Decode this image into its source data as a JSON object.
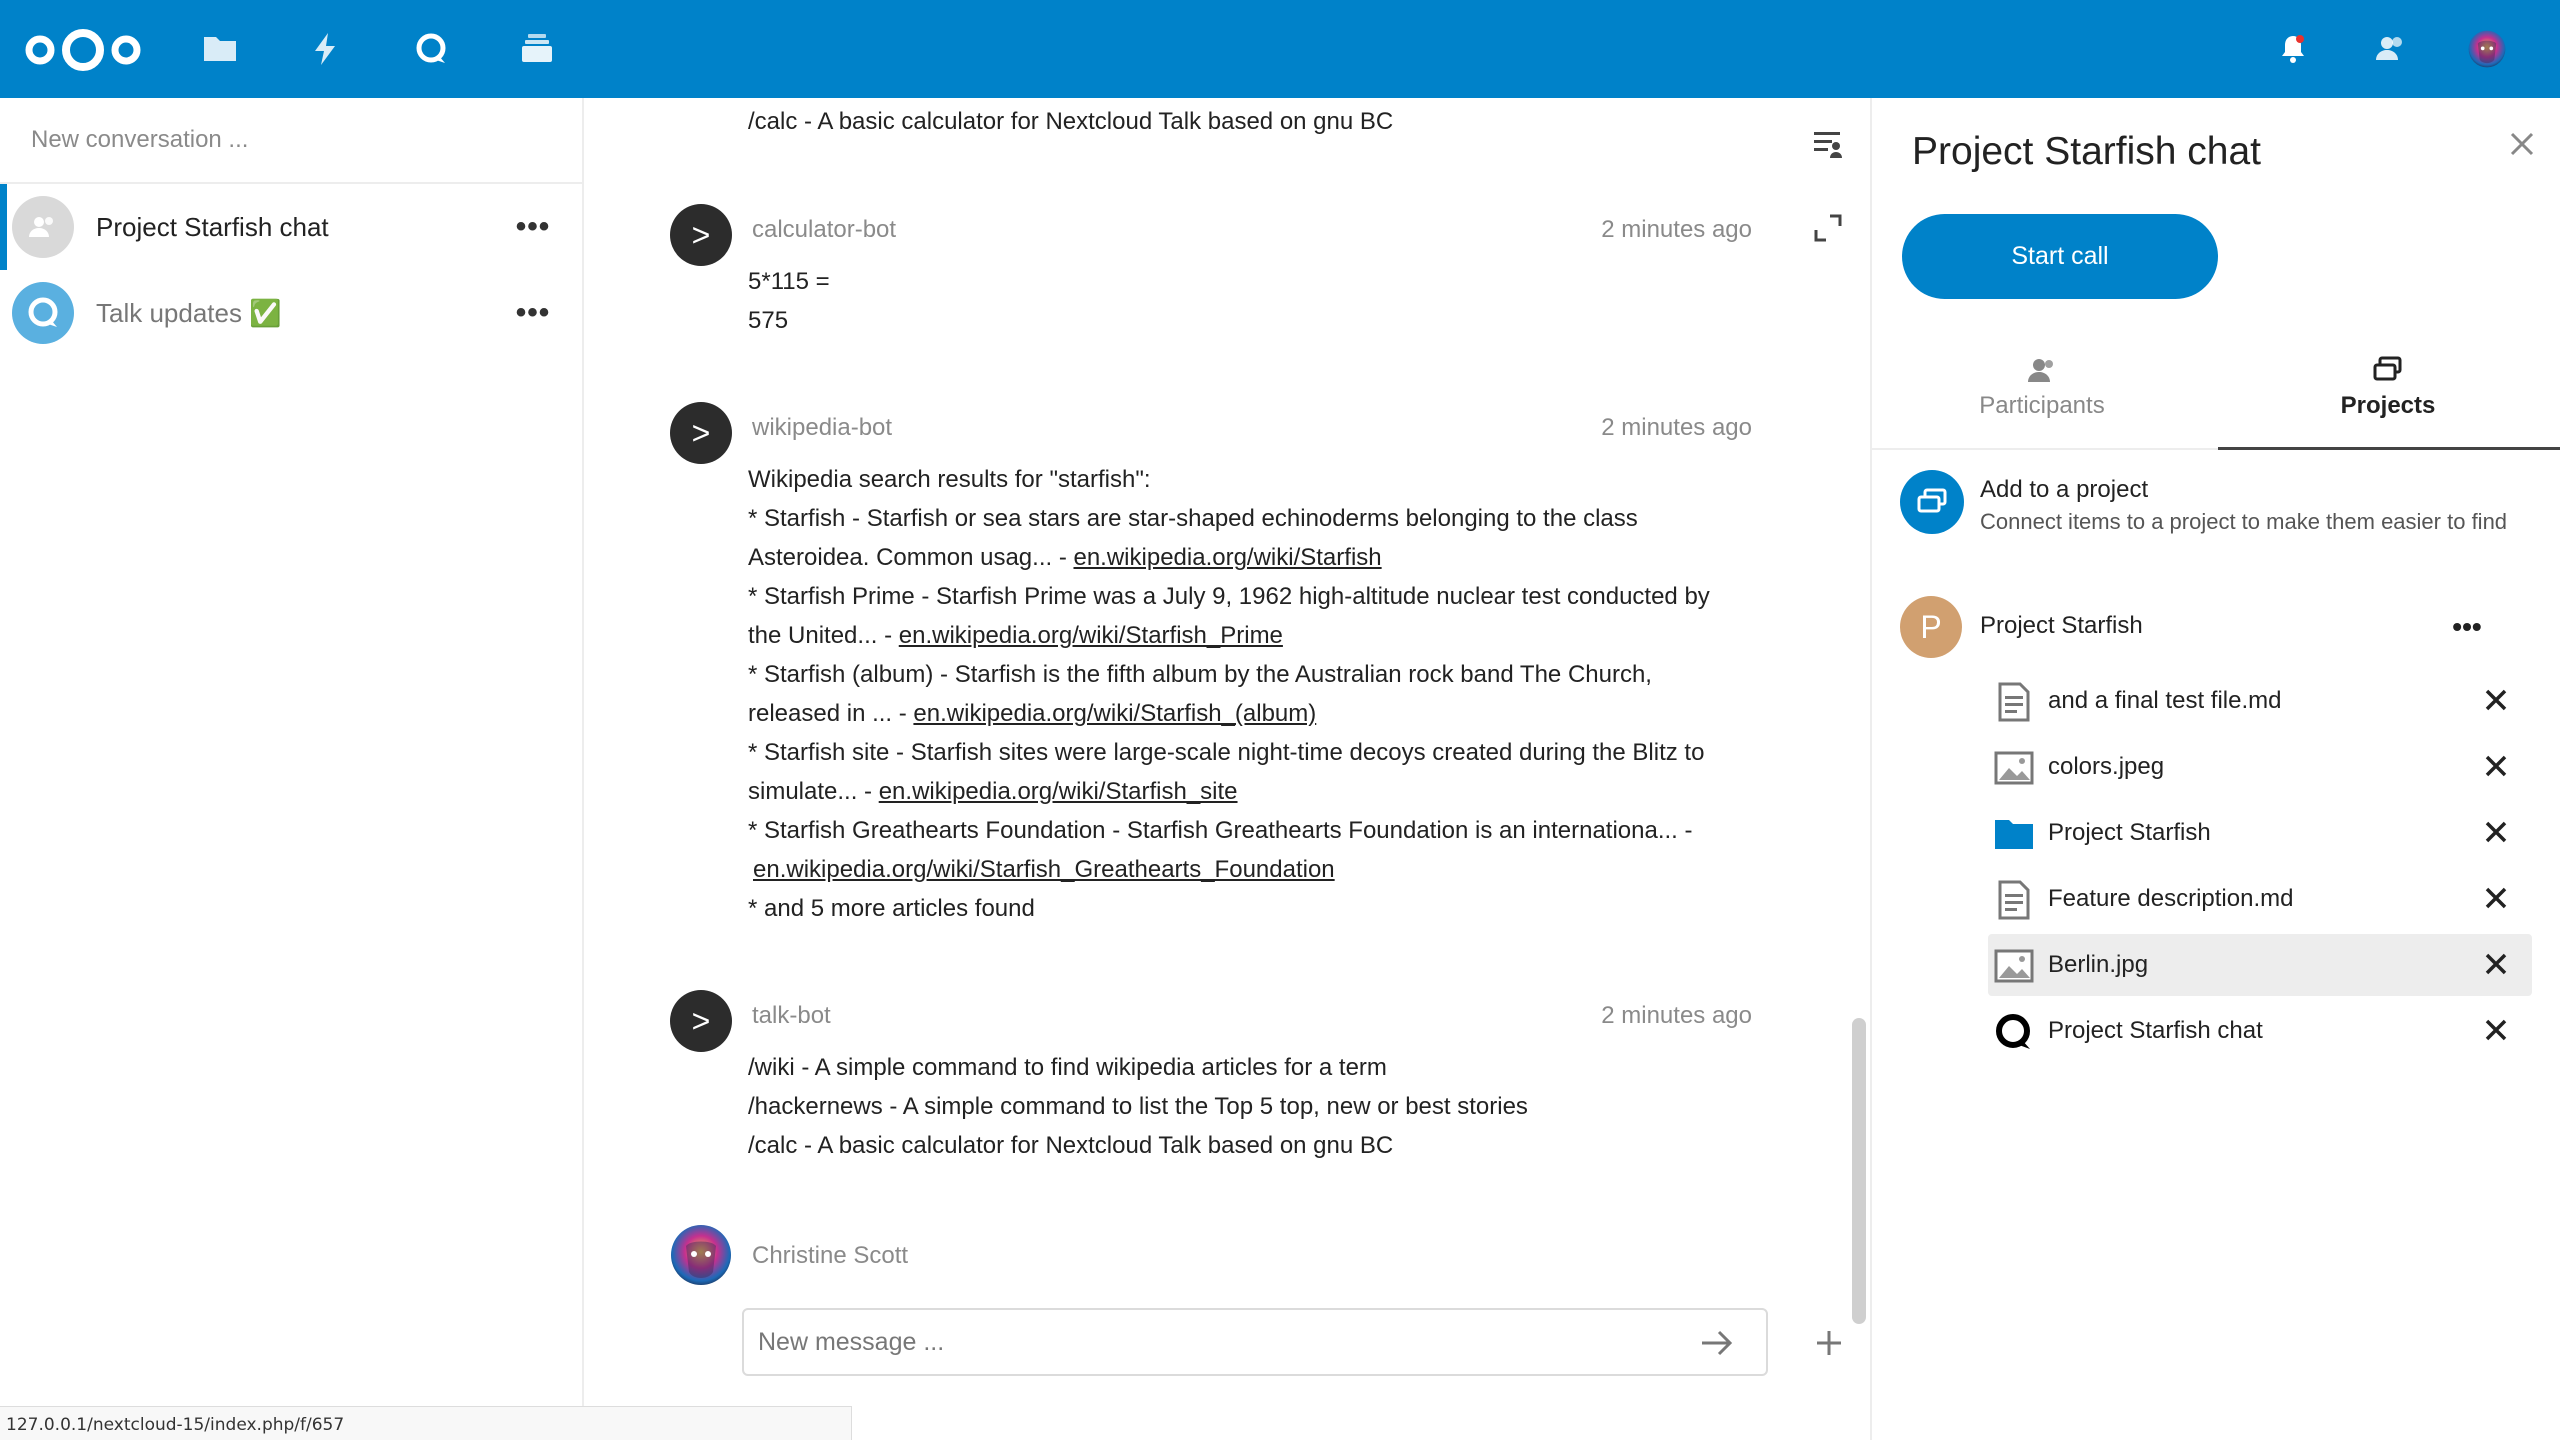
{
  "header": {
    "app_icons": [
      "files-icon",
      "activity-icon",
      "talk-icon",
      "deck-icon"
    ],
    "right_icons": [
      "notifications-icon",
      "contacts-icon",
      "user-avatar"
    ],
    "accent": "#0082c9"
  },
  "sidebar": {
    "search_placeholder": "New conversation ...",
    "conversations": [
      {
        "name": "Project Starfish chat",
        "active": true
      },
      {
        "name": "Talk updates ✅",
        "active": false
      }
    ]
  },
  "chat": {
    "top_line": "/calc - A basic calculator for Nextcloud Talk based on gnu BC",
    "messages": [
      {
        "author": "calculator-bot",
        "time": "2 minutes ago",
        "lines": [
          "5*115 =",
          "575"
        ]
      },
      {
        "author": "wikipedia-bot",
        "time": "2 minutes ago",
        "intro": "Wikipedia search results for \"starfish\":",
        "results": [
          {
            "text1": "* Starfish - Starfish or sea stars are star-shaped echinoderms belonging to the class",
            "text2": "Asteroidea. Common usag... - ",
            "link": "en.wikipedia.org/wiki/Starfish"
          },
          {
            "text1": "* Starfish Prime - Starfish Prime was a July 9, 1962 high-altitude nuclear test conducted by",
            "text2": "the United... - ",
            "link": "en.wikipedia.org/wiki/Starfish_Prime"
          },
          {
            "text1": "* Starfish (album) - Starfish is the fifth album by the Australian rock band The Church,",
            "text2": "released in ... - ",
            "link": "en.wikipedia.org/wiki/Starfish_(album)"
          },
          {
            "text1": "* Starfish site - Starfish sites were large-scale night-time decoys created during the Blitz to",
            "text2": "simulate... - ",
            "link": "en.wikipedia.org/wiki/Starfish_site"
          },
          {
            "text1": "* Starfish Greathearts Foundation - Starfish Greathearts Foundation is an internationa... -",
            "text2": "",
            "link": "en.wikipedia.org/wiki/Starfish_Greathearts_Foundation"
          }
        ],
        "footer": "* and 5 more articles found"
      },
      {
        "author": "talk-bot",
        "time": "2 minutes ago",
        "lines": [
          "/wiki - A simple command to find wikipedia articles for a term",
          "/hackernews - A simple command to list the Top 5 top, new or best stories",
          "/calc - A basic calculator for Nextcloud Talk based on gnu BC"
        ]
      }
    ],
    "current_user": "Christine Scott",
    "composer_placeholder": "New message ..."
  },
  "status_url": "127.0.0.1/nextcloud-15/index.php/f/657",
  "right": {
    "title": "Project Starfish chat",
    "start_call": "Start call",
    "tabs": [
      {
        "label": "Participants",
        "active": false
      },
      {
        "label": "Projects",
        "active": true
      }
    ],
    "add_project": {
      "title": "Add to a project",
      "desc": "Connect items to a project to make them easier to find"
    },
    "project": {
      "initial": "P",
      "name": "Project Starfish",
      "resources": [
        {
          "name": "and a final test file.md",
          "icon": "text-file-icon"
        },
        {
          "name": "colors.jpeg",
          "icon": "image-file-icon"
        },
        {
          "name": "Project Starfish",
          "icon": "folder-icon"
        },
        {
          "name": "Feature description.md",
          "icon": "text-file-icon"
        },
        {
          "name": "Berlin.jpg",
          "icon": "image-file-icon"
        },
        {
          "name": "Project Starfish chat",
          "icon": "talk-icon"
        }
      ]
    }
  }
}
